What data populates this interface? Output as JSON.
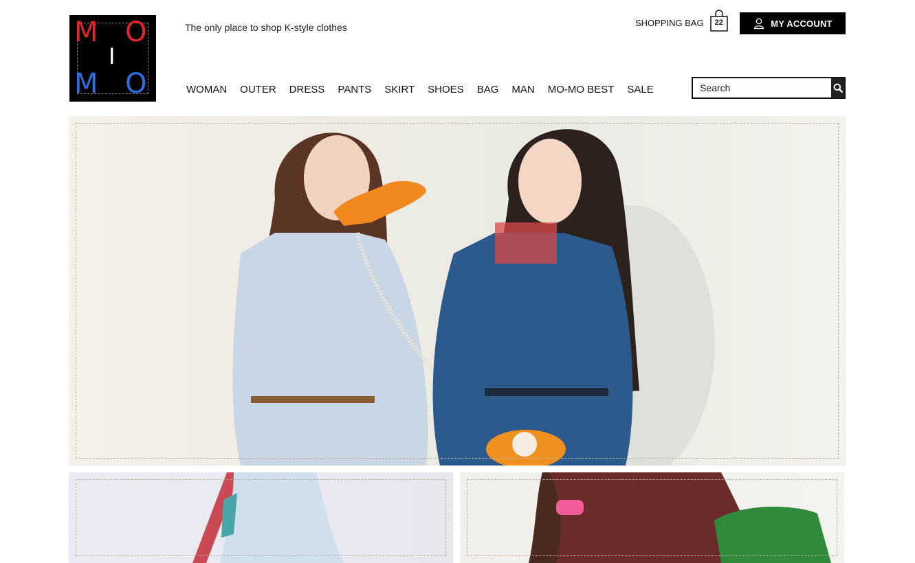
{
  "brand": {
    "logo_letters": [
      "M",
      "O",
      "I",
      "M",
      "O"
    ],
    "logo_colors": {
      "red": "#e0262a",
      "blue": "#2b6fe0",
      "white": "#ffffff",
      "background": "#000000"
    },
    "tagline": "The only place to shop K-style clothes"
  },
  "header": {
    "shopping_bag_label": "SHOPPING BAG",
    "bag_count": "22",
    "account_label": "MY ACCOUNT",
    "account_icon": "user-icon",
    "bag_icon": "shopping-bag-icon"
  },
  "nav": {
    "items": [
      "WOMAN",
      "OUTER",
      "DRESS",
      "PANTS",
      "SKIRT",
      "SHOES",
      "BAG",
      "MAN",
      "MO-MO BEST",
      "SALE"
    ]
  },
  "search": {
    "placeholder": "Search",
    "icon": "search-icon"
  },
  "colors": {
    "accent": "#000000",
    "frame_dash": "#b8b0a4"
  }
}
